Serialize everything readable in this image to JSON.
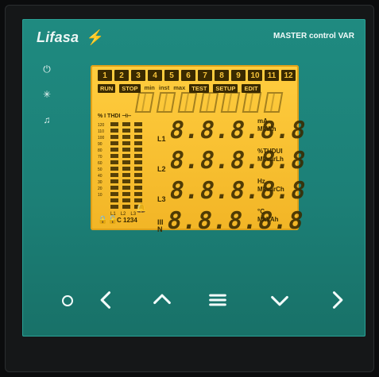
{
  "brand": {
    "logo_text": "Lifasa",
    "logo_mark": "⚡",
    "model": "MASTER control VAR"
  },
  "side_icons": [
    {
      "name": "power-icon",
      "glyph": "⏻"
    },
    {
      "name": "sun-icon",
      "glyph": "✳"
    },
    {
      "name": "bell-icon",
      "glyph": "🔔"
    }
  ],
  "lcd": {
    "tabs": [
      "1",
      "2",
      "3",
      "4",
      "5",
      "6",
      "7",
      "8",
      "9",
      "10",
      "11",
      "12"
    ],
    "modes": {
      "run": "RUN",
      "stop": "STOP",
      "min": "min",
      "inst": "inst",
      "max": "max",
      "test": "TEST",
      "setup": "SETUP",
      "edit": "EDIT"
    },
    "meter_header": "%  I  THDI  ⊣⊢",
    "scale": [
      "120",
      "110",
      "100",
      "90",
      "80",
      "70",
      "60",
      "50",
      "40",
      "30",
      "20",
      "10"
    ],
    "bar_labels": [
      "L1",
      "L2",
      "L3"
    ],
    "c_label": "C 1234",
    "rows": [
      {
        "label": "L1",
        "digits": "8.8.8.8.8",
        "unit1": "mA",
        "unit2": "MkWh"
      },
      {
        "label": "L2",
        "digits": "8.8.8.8.8",
        "unit1": "%THDUI",
        "unit2": "MkvarLh"
      },
      {
        "label": "L3",
        "digits": "8.8.8.8.8",
        "unit1": "Hz",
        "unit2": "MkvarCh"
      },
      {
        "label": "III N",
        "digits": "8.8.8.8.8",
        "unit1": "°C",
        "unit2": "MkVAh"
      }
    ]
  },
  "buttons": {
    "dot": "dot",
    "left": "left",
    "up": "up",
    "menu": "menu",
    "down": "down",
    "right": "right"
  }
}
